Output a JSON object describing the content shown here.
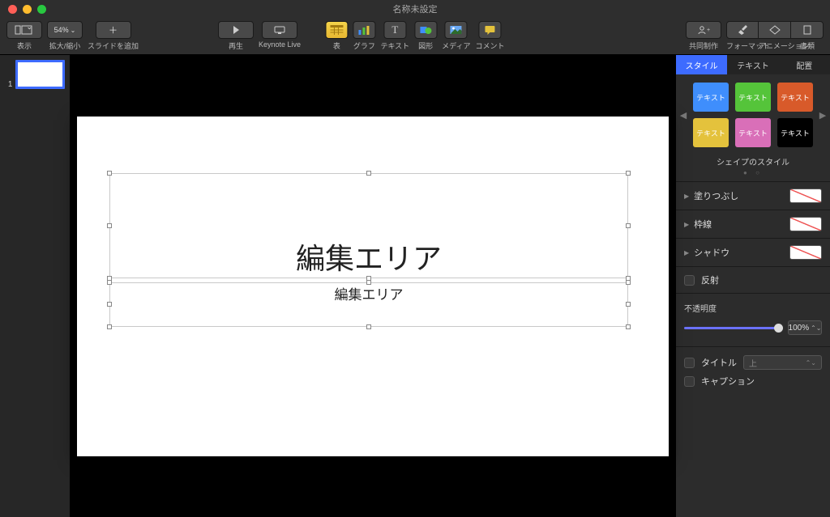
{
  "window": {
    "title": "名称未設定"
  },
  "toolbar": {
    "view_label": "表示",
    "zoom_value": "54%",
    "zoom_label": "拡大/縮小",
    "add_slide_label": "スライドを追加",
    "play_label": "再生",
    "keynote_live_label": "Keynote Live",
    "table_label": "表",
    "chart_label": "グラフ",
    "text_label": "テキスト",
    "shape_label": "図形",
    "media_label": "メディア",
    "comment_label": "コメント",
    "collaborate_label": "共同制作",
    "format_label": "フォーマット",
    "animate_label": "アニメーション",
    "document_label": "書類"
  },
  "navigator": {
    "slides": [
      {
        "index": "1"
      }
    ]
  },
  "slide": {
    "title_text": "編集エリア",
    "subtitle_text": "編集エリア"
  },
  "inspector": {
    "tabs": {
      "style": "スタイル",
      "text": "テキスト",
      "arrange": "配置"
    },
    "swatches": [
      {
        "label": "テキスト",
        "bg": "#3f8efc"
      },
      {
        "label": "テキスト",
        "bg": "#55c43a"
      },
      {
        "label": "テキスト",
        "bg": "#d85a2a"
      },
      {
        "label": "テキスト",
        "bg": "#e4c23c"
      },
      {
        "label": "テキスト",
        "bg": "#d96fb8"
      },
      {
        "label": "テキスト",
        "bg": "#000000"
      }
    ],
    "shape_style_title": "シェイプのスタイル",
    "fill_label": "塗りつぶし",
    "border_label": "枠線",
    "shadow_label": "シャドウ",
    "reflection_label": "反射",
    "opacity_label": "不透明度",
    "opacity_value": "100%",
    "title_checkbox_label": "タイトル",
    "title_position_value": "上",
    "caption_checkbox_label": "キャプション"
  }
}
